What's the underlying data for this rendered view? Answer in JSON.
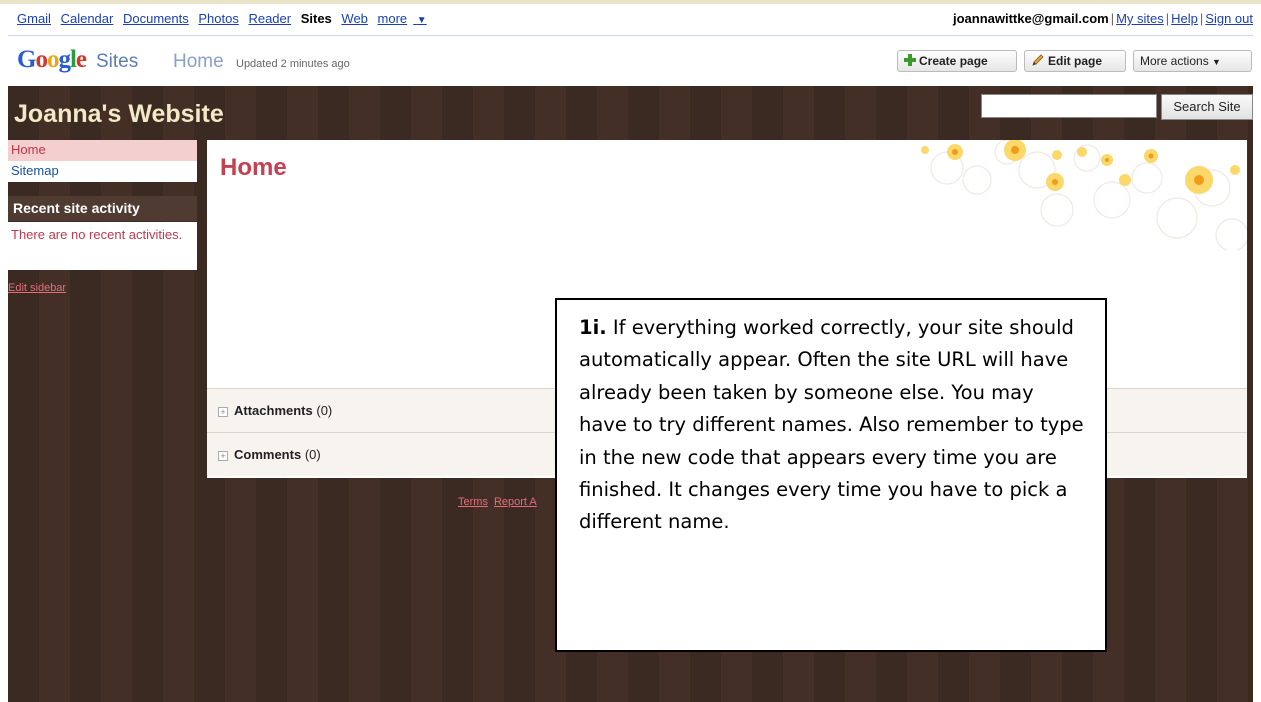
{
  "gbar": {
    "links": [
      "Gmail",
      "Calendar",
      "Documents",
      "Photos",
      "Reader"
    ],
    "active": "Sites",
    "web": "Web",
    "more": "more",
    "email": "joannawittke@gmail.com",
    "my_sites": "My sites",
    "help": "Help",
    "sign_out": "Sign out"
  },
  "header": {
    "logo": "Google",
    "product": "Sites",
    "page": "Home",
    "updated": "Updated 2 minutes ago",
    "create_page": "Create page",
    "edit_page": "Edit page",
    "more_actions": "More actions"
  },
  "site": {
    "title": "Joanna's Website",
    "search_button": "Search Site",
    "search_value": ""
  },
  "sidebar": {
    "items": [
      "Home",
      "Sitemap"
    ],
    "recent_heading": "Recent site activity",
    "recent_text": "There are no recent activities.",
    "edit_sidebar": "Edit sidebar"
  },
  "content": {
    "title": "Home",
    "attachments_label": "Attachments",
    "attachments_count": "(0)",
    "comments_label": "Comments",
    "comments_count": "(0)"
  },
  "footer": {
    "terms": "Terms",
    "report": "Report A"
  },
  "callout": {
    "step": "1i.",
    "text": "If everything worked correctly, your site should automatically appear. Often the site URL will have already been taken by someone else. You may have to try different names. Also remember to type in the new code that appears every time you are finished. It changes every time you have to pick a different name."
  }
}
